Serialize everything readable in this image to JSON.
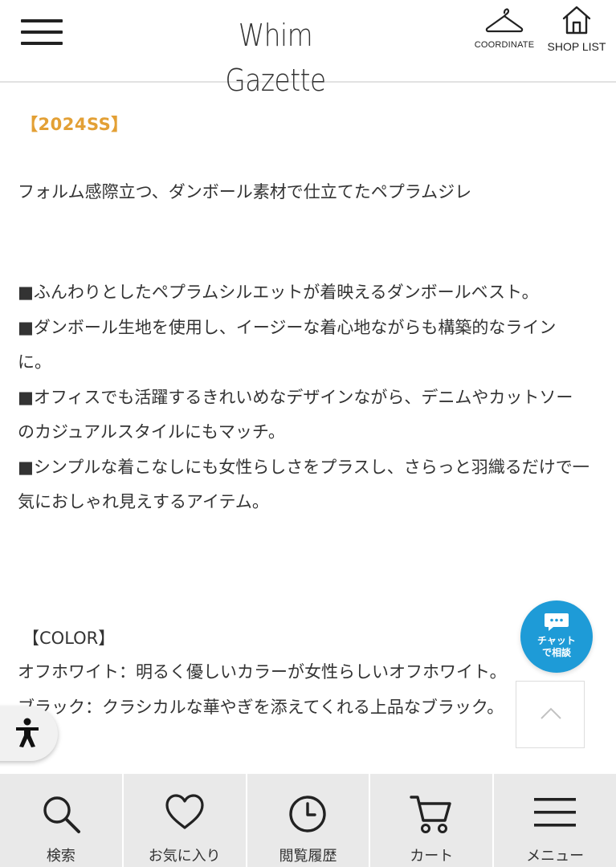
{
  "header": {
    "logo": "Whim Gazette",
    "coordinate_label": "COORDINATE",
    "shop_list_label": "SHOP LIST"
  },
  "content": {
    "season_tag": "【2024SS】",
    "lead": "フォルム感際立つ、ダンボール素材で仕立てたペプラムジレ",
    "bullets": [
      "■ふんわりとしたペプラムシルエットが着映えるダンボールベスト。",
      "■ダンボール生地を使用し、イージーな着心地ながらも構築的なラインに。",
      "■オフィスでも活躍するきれいめなデザインながら、デニムやカットソーのカジュアルスタイルにもマッチ。",
      "■シンプルな着こなしにも女性らしさをプラスし、さらっと羽織るだけで一気におしゃれ見えするアイテム。"
    ],
    "color_title": "【COLOR】",
    "colors": [
      "オフホワイト：明るく優しいカラーが女性らしいオフホワイト。",
      "ブラック：クラシカルな華やぎを添えてくれる上品なブラック。"
    ]
  },
  "chat": {
    "line1": "チャット",
    "line2": "で相談"
  },
  "icons": {
    "menu": "hamburger-menu-icon",
    "coordinate": "hanger-icon",
    "shop_list": "house-icon",
    "chat": "chat-bubble-icon",
    "to_top": "chevron-up-icon",
    "accessibility": "accessibility-person-icon"
  },
  "bottom_nav": [
    {
      "label": "検索",
      "icon": "search-icon"
    },
    {
      "label": "お気に入り",
      "icon": "heart-icon"
    },
    {
      "label": "閲覧履歴",
      "icon": "clock-icon"
    },
    {
      "label": "カート",
      "icon": "cart-icon"
    },
    {
      "label": "メニュー",
      "icon": "menu-icon"
    }
  ],
  "colors": {
    "accent_orange": "#e3a035",
    "chat_blue": "#1e9bd7",
    "text": "#333333",
    "nav_bg": "#e9e9e9"
  }
}
